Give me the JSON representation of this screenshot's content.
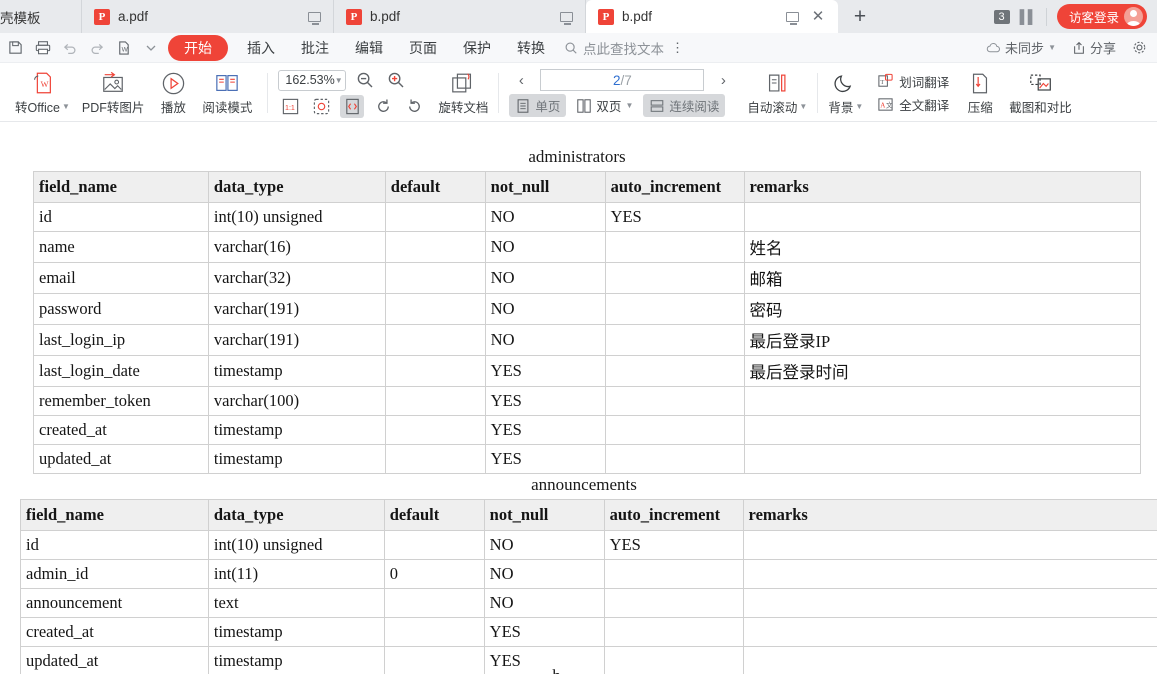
{
  "tabbar": {
    "tabs": [
      {
        "label": "壳模板",
        "icon": "template-icon",
        "active": false,
        "partial": true
      },
      {
        "label": "a.pdf",
        "icon": "pdf-icon",
        "active": false,
        "partial": false
      },
      {
        "label": "b.pdf",
        "icon": "pdf-icon",
        "active": false,
        "partial": false
      },
      {
        "label": "b.pdf",
        "icon": "pdf-icon",
        "active": true,
        "partial": false
      }
    ],
    "new_tab_label": "+",
    "window_count": "3",
    "login_label": "访客登录"
  },
  "menu": {
    "quick_icons": [
      "save-icon",
      "print-icon",
      "undo-icon",
      "redo-icon",
      "export-word-icon",
      "customize-icon"
    ],
    "items": [
      {
        "label": "开始",
        "active": true
      },
      {
        "label": "插入",
        "active": false
      },
      {
        "label": "批注",
        "active": false
      },
      {
        "label": "编辑",
        "active": false
      },
      {
        "label": "页面",
        "active": false
      },
      {
        "label": "保护",
        "active": false
      },
      {
        "label": "转换",
        "active": false
      }
    ],
    "find_placeholder": "点此查找文本",
    "sync_label": "未同步",
    "share_label": "分享"
  },
  "toolbar": {
    "to_office_label": "转Office",
    "pdf_to_image_label": "PDF转图片",
    "play_label": "播放",
    "read_mode_label": "阅读模式",
    "zoom_value": "162.53%",
    "zoom_out_name": "zoom-out",
    "zoom_in_name": "zoom-in",
    "fit_actual_label": "1:1",
    "rotate_doc_label": "旋转文档",
    "page_current": "2",
    "page_sep": "/",
    "page_total": "7",
    "single_page_label": "单页",
    "double_page_label": "双页",
    "continuous_label": "连续阅读",
    "auto_scroll_label": "自动滚动",
    "background_label": "背景",
    "word_translate_label": "划词翻译",
    "full_translate_label": "全文翻译",
    "compress_label": "压缩",
    "screenshot_compare_label": "截图和对比"
  },
  "document": {
    "columns": [
      "field_name",
      "data_type",
      "default",
      "not_null",
      "auto_increment",
      "remarks"
    ],
    "tables": [
      {
        "title": "administrators",
        "rows": [
          [
            "id",
            "int(10) unsigned",
            "",
            "NO",
            "YES",
            ""
          ],
          [
            "name",
            "varchar(16)",
            "",
            "NO",
            "",
            "姓名"
          ],
          [
            "email",
            "varchar(32)",
            "",
            "NO",
            "",
            "邮箱"
          ],
          [
            "password",
            "varchar(191)",
            "",
            "NO",
            "",
            "密码"
          ],
          [
            "last_login_ip",
            "varchar(191)",
            "",
            "NO",
            "",
            "最后登录IP"
          ],
          [
            "last_login_date",
            "timestamp",
            "",
            "YES",
            "",
            "最后登录时间"
          ],
          [
            "remember_token",
            "varchar(100)",
            "",
            "YES",
            "",
            ""
          ],
          [
            "created_at",
            "timestamp",
            "",
            "YES",
            "",
            ""
          ],
          [
            "updated_at",
            "timestamp",
            "",
            "YES",
            "",
            ""
          ]
        ]
      },
      {
        "title": "announcements",
        "rows": [
          [
            "id",
            "int(10) unsigned",
            "",
            "NO",
            "YES",
            ""
          ],
          [
            "admin_id",
            "int(11)",
            "0",
            "NO",
            "",
            ""
          ],
          [
            "announcement",
            "text",
            "",
            "NO",
            "",
            ""
          ],
          [
            "created_at",
            "timestamp",
            "",
            "YES",
            "",
            ""
          ],
          [
            "updated_at",
            "timestamp",
            "",
            "YES",
            "",
            ""
          ]
        ]
      }
    ],
    "next_table_title_partial": "h"
  }
}
